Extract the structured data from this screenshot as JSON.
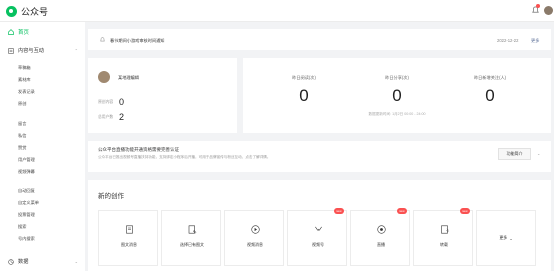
{
  "header": {
    "app_name": "公众号",
    "icons": [
      "logo-icon",
      "bell-icon",
      "avatar"
    ],
    "accent": "#07c160",
    "badge_color": "#fa5151"
  },
  "sidebar": {
    "home_label": "首页",
    "section_content_label": "内容与互动",
    "content_items": [
      "草稿箱",
      "素材库",
      "发表记录",
      "原创"
    ],
    "interaction_items": [
      "留言",
      "私信",
      "赞赏",
      "用户管理",
      "视频弹幕"
    ],
    "function_items": [
      "自动回复",
      "自定义菜单",
      "投票管理",
      "搜索",
      "号内搜索"
    ],
    "section_data_label": "数据"
  },
  "notice": {
    "text": "春节期间小游戏审核时间通知",
    "date": "2022-12-22",
    "more": "更多"
  },
  "account": {
    "name": "某地理编辑",
    "row1_label": "原创内容",
    "row1_value": "0",
    "row2_label": "总用户数",
    "row2_value": "2"
  },
  "stats": {
    "items": [
      {
        "label": "昨日阅读(次)",
        "value": "0"
      },
      {
        "label": "昨日分享(次)",
        "value": "0"
      },
      {
        "label": "昨日新增关注(人)",
        "value": "0"
      }
    ],
    "footer": "数据更新时间: 1月2日 00:00 - 24:00"
  },
  "promo": {
    "title": "公众平台直播功能开通资格需要完善认证",
    "desc": "公众平台已推出视频号直播扶持功能，支持绑定小程序后开播，可用于品牌宣传与粉丝互动，点击了解详情。",
    "button": "功能简介"
  },
  "create": {
    "heading": "新的创作",
    "new_badge": "new",
    "tiles": [
      {
        "label": "图文消息",
        "sub": "",
        "icon": "article-icon",
        "new": false
      },
      {
        "label": "选择已有图文",
        "sub": "",
        "icon": "select-article-icon",
        "new": false
      },
      {
        "label": "视频消息",
        "sub": "",
        "icon": "video-icon",
        "new": false
      },
      {
        "label": "视频号",
        "sub": "",
        "icon": "channels-icon",
        "new": true
      },
      {
        "label": "直播",
        "sub": "",
        "icon": "live-icon",
        "new": true
      },
      {
        "label": "转载",
        "sub": "",
        "icon": "repost-icon",
        "new": true
      }
    ],
    "more": "更多"
  }
}
